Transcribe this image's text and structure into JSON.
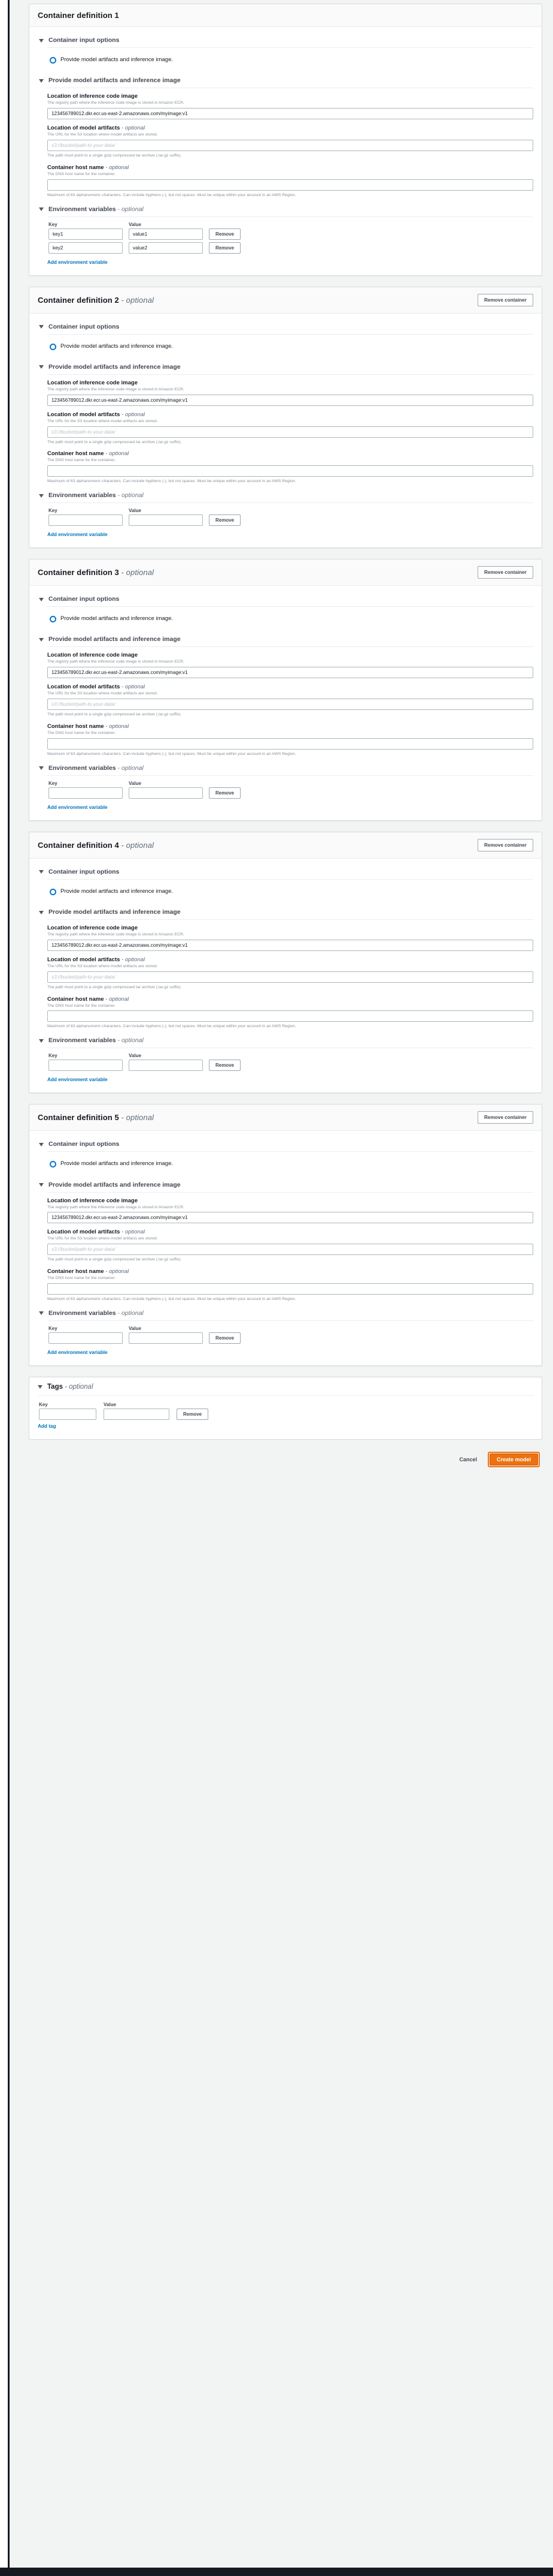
{
  "colors": {
    "accent_blue": "#0972d3",
    "link_blue": "#0073bb",
    "primary_orange": "#ec7211",
    "border_grey": "#d5dbdb",
    "page_bg": "#f2f3f3"
  },
  "labels": {
    "container_input_options": "Container input options",
    "provide_model_artifacts": "Provide model artifacts and inference image",
    "radio_provide": "Provide model artifacts and inference image.",
    "environment_variables": "Environment variables",
    "optional_suffix": "- optional",
    "optional_word": "optional",
    "remove_container": "Remove container",
    "add_environment_variable": "Add environment variable",
    "remove": "Remove",
    "key_header": "Key",
    "value_header": "Value"
  },
  "fields": {
    "inference_image": {
      "label": "Location of inference code image",
      "description": "The registry path where the inference code image is stored in Amazon ECR.",
      "value": "123456789012.dkr.ecr.us-east-2.amazonaws.com/myimage:v1",
      "placeholder": ""
    },
    "model_artifacts": {
      "label": "Location of model artifacts",
      "optional": "- optional",
      "description": "The URL for the S3 location where model artifacts are stored.",
      "placeholder": "s3://bucket/path-to-your-data/",
      "value": "",
      "hint": "The path must point to a single gzip compressed tar archive (.tar.gz suffix)."
    },
    "container_host_name": {
      "label": "Container host name",
      "optional": "- optional",
      "description": "The DNS host name for the container.",
      "placeholder": "",
      "value": "",
      "hint": "Maximum of 63 alphanumeric characters. Can include hyphens (-), but not spaces. Must be unique within your account in an AWS Region."
    }
  },
  "containers": [
    {
      "title": "Container definition 1",
      "optional": "",
      "has_remove": false,
      "env_vars": [
        {
          "key": "key1",
          "value": "value1"
        },
        {
          "key": "key2",
          "value": "value2"
        }
      ]
    },
    {
      "title": "Container definition 2",
      "optional": "- optional",
      "has_remove": true,
      "env_vars": [
        {
          "key": "",
          "value": ""
        }
      ]
    },
    {
      "title": "Container definition 3",
      "optional": "- optional",
      "has_remove": true,
      "env_vars": [
        {
          "key": "",
          "value": ""
        }
      ]
    },
    {
      "title": "Container definition 4",
      "optional": "- optional",
      "has_remove": true,
      "env_vars": [
        {
          "key": "",
          "value": ""
        }
      ]
    },
    {
      "title": "Container definition 5",
      "optional": "- optional",
      "has_remove": true,
      "env_vars": [
        {
          "key": "",
          "value": ""
        }
      ]
    }
  ],
  "tags": {
    "title": "Tags",
    "optional": "- optional",
    "key_header": "Key",
    "value_header": "Value",
    "remove_label": "Remove",
    "add_tag_label": "Add tag",
    "rows": [
      {
        "key": "",
        "value": ""
      }
    ]
  },
  "footer": {
    "cancel_label": "Cancel",
    "create_label": "Create model"
  }
}
